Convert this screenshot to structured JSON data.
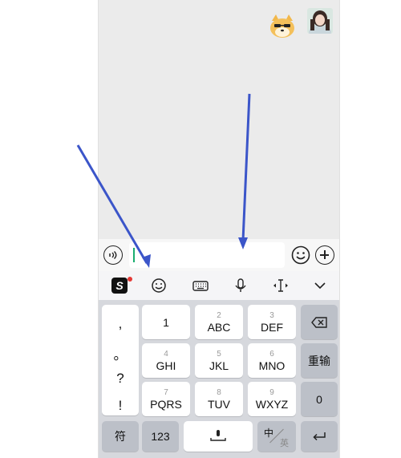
{
  "keyboard": {
    "punctuation": [
      ",",
      "。",
      "?",
      "!"
    ],
    "keys": [
      {
        "sub": "",
        "main": "1"
      },
      {
        "sub": "2",
        "main": "ABC"
      },
      {
        "sub": "3",
        "main": "DEF"
      },
      {
        "sub": "4",
        "main": "GHI"
      },
      {
        "sub": "5",
        "main": "JKL"
      },
      {
        "sub": "6",
        "main": "MNO"
      },
      {
        "sub": "7",
        "main": "PQRS"
      },
      {
        "sub": "8",
        "main": "TUV"
      },
      {
        "sub": "9",
        "main": "WXYZ"
      }
    ],
    "reinput_label": "重输",
    "zero_label": "0",
    "symbol_label": "符",
    "num_label": "123",
    "lang_cn": "中",
    "lang_en": "英"
  },
  "colors": {
    "accent": "#1aad6f",
    "annotation_arrow": "#3b55c9",
    "badge": "#e53935"
  },
  "icons": [
    "voice-icon",
    "emoji-icon",
    "plus-icon",
    "sogou-logo",
    "smiley-icon",
    "keyboard-icon",
    "mic-icon",
    "cursor-move-icon",
    "collapse-icon",
    "backspace-icon",
    "space-mic-icon",
    "enter-icon"
  ]
}
